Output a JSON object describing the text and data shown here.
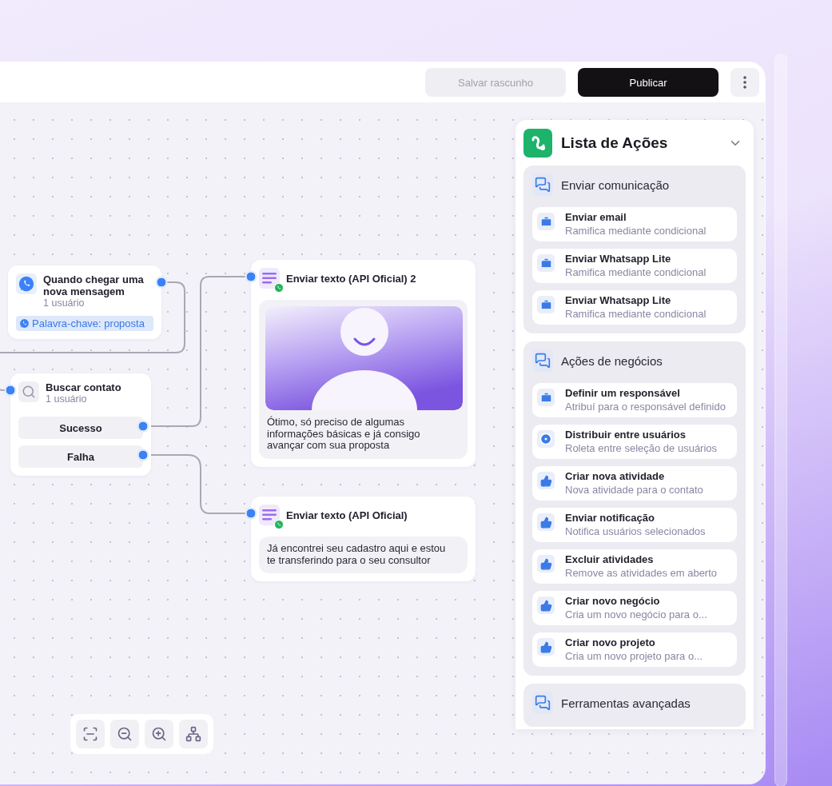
{
  "toolbar": {
    "buttons": [
      {
        "label": "Salvar rascunho",
        "disabled": true
      },
      {
        "label": "Publicar",
        "disabled": false
      }
    ]
  },
  "canvas": {
    "trigger": {
      "title": "Quando chegar uma nova mensagem",
      "subtitle": "1 usuário",
      "tag": "Palavra-chave: proposta"
    },
    "search": {
      "title": "Buscar contato",
      "subtitle": "1 usuário",
      "outputs": [
        "Sucesso",
        "Falha"
      ]
    },
    "messages": [
      {
        "title": "Enviar texto (API Oficial) 2",
        "has_image": true,
        "text": "Ótimo, só preciso de algumas informações básicas e já consigo avançar com sua proposta"
      },
      {
        "title": "Enviar texto (API Oficial)",
        "has_image": false,
        "text": "Já encontrei seu cadastro aqui e estou te transferindo para o seu consultor"
      }
    ]
  },
  "actions_panel": {
    "title": "Lista de Ações",
    "expanded": true,
    "groups": [
      {
        "title": "Enviar comunicação",
        "items": [
          {
            "kind": "briefcase",
            "title": "Enviar email",
            "subtitle": "Ramifica mediante condicional"
          },
          {
            "kind": "briefcase",
            "title": "Enviar Whatsapp Lite",
            "subtitle": "Ramifica mediante condicional"
          },
          {
            "kind": "briefcase",
            "title": "Enviar Whatsapp Lite",
            "subtitle": "Ramifica mediante condicional"
          }
        ]
      },
      {
        "title": "Ações de negócios",
        "items": [
          {
            "kind": "briefcase",
            "title": "Definir um responsável",
            "subtitle": "Atribuí para o responsável definido"
          },
          {
            "kind": "target",
            "title": "Distribuir entre usuários",
            "subtitle": "Roleta entre seleção de usuários"
          },
          {
            "kind": "like",
            "title": "Criar nova atividade",
            "subtitle": "Nova atividade para o contato"
          },
          {
            "kind": "like",
            "title": "Enviar notificação",
            "subtitle": "Notifica usuários selecionados"
          },
          {
            "kind": "like",
            "title": "Excluir atividades",
            "subtitle": "Remove as atividades em aberto"
          },
          {
            "kind": "like",
            "title": "Criar novo negócio",
            "subtitle": "Cria um novo negócio para o..."
          },
          {
            "kind": "like",
            "title": "Criar novo projeto",
            "subtitle": "Cria um novo projeto para o..."
          }
        ]
      },
      {
        "title": "Ferramentas avançadas"
      }
    ]
  }
}
